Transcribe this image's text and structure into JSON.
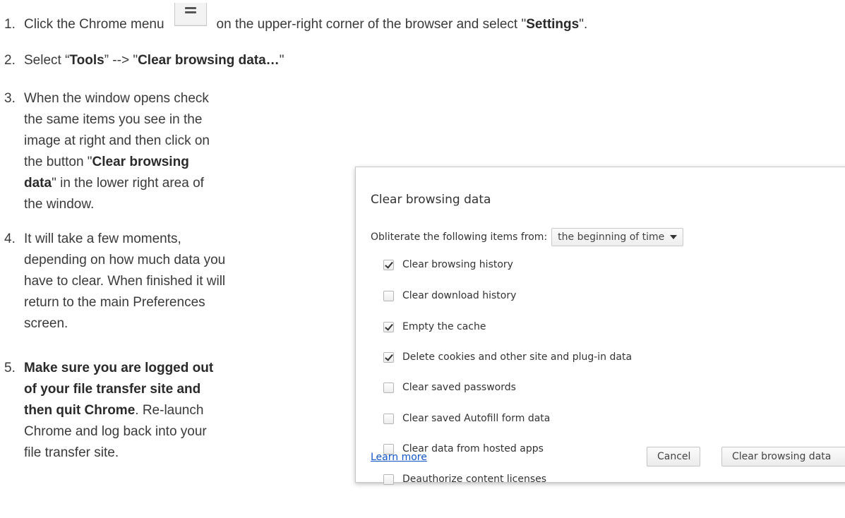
{
  "steps": [
    {
      "num": "1.",
      "parts": [
        "Click the Chrome menu",
        "on the upper-right corner of the browser and select \"",
        "Settings",
        "\"."
      ]
    },
    {
      "num": "2.",
      "parts": [
        "Select “",
        "Tools",
        "” --> \"",
        "Clear browsing data…",
        "\""
      ]
    },
    {
      "num": "3.",
      "lines": [
        "When the window opens check",
        "the same items you see in the",
        "image at right and then click on",
        "the button \"",
        "Clear browsing",
        "data",
        "\" in the lower right area of",
        "the window."
      ]
    },
    {
      "num": "4.",
      "lines": [
        "It will take a few moments,",
        "depending on how much data you",
        "have to clear. When finished it will",
        "return to the main Preferences",
        "screen."
      ]
    },
    {
      "num": "5.",
      "lines": [
        "Make sure you are logged out",
        "of your file transfer site and",
        "then quit Chrome",
        ". Re-launch",
        "Chrome and log back into your",
        "file transfer site."
      ]
    }
  ],
  "icons": {
    "menu": "hamburger-menu-icon",
    "dropdown": "caret-down-icon",
    "checkbox": "checkbox-icon"
  },
  "dialog": {
    "title": "Clear browsing data",
    "from_label": "Obliterate the following items from:",
    "from_value": "the beginning of time",
    "options": [
      {
        "label": "Clear browsing history",
        "checked": true
      },
      {
        "label": "Clear download history",
        "checked": false
      },
      {
        "label": "Empty the cache",
        "checked": true
      },
      {
        "label": "Delete cookies and other site and plug-in data",
        "checked": true
      },
      {
        "label": "Clear saved passwords",
        "checked": false
      },
      {
        "label": "Clear saved Autofill form data",
        "checked": false
      },
      {
        "label": "Clear data from hosted apps",
        "checked": false
      },
      {
        "label": "Deauthorize content licenses",
        "checked": false
      }
    ],
    "learn_more": "Learn more",
    "cancel_label": "Cancel",
    "confirm_label": "Clear browsing data"
  },
  "colors": {
    "link": "#1155cc",
    "text": "#3a3a3a"
  }
}
